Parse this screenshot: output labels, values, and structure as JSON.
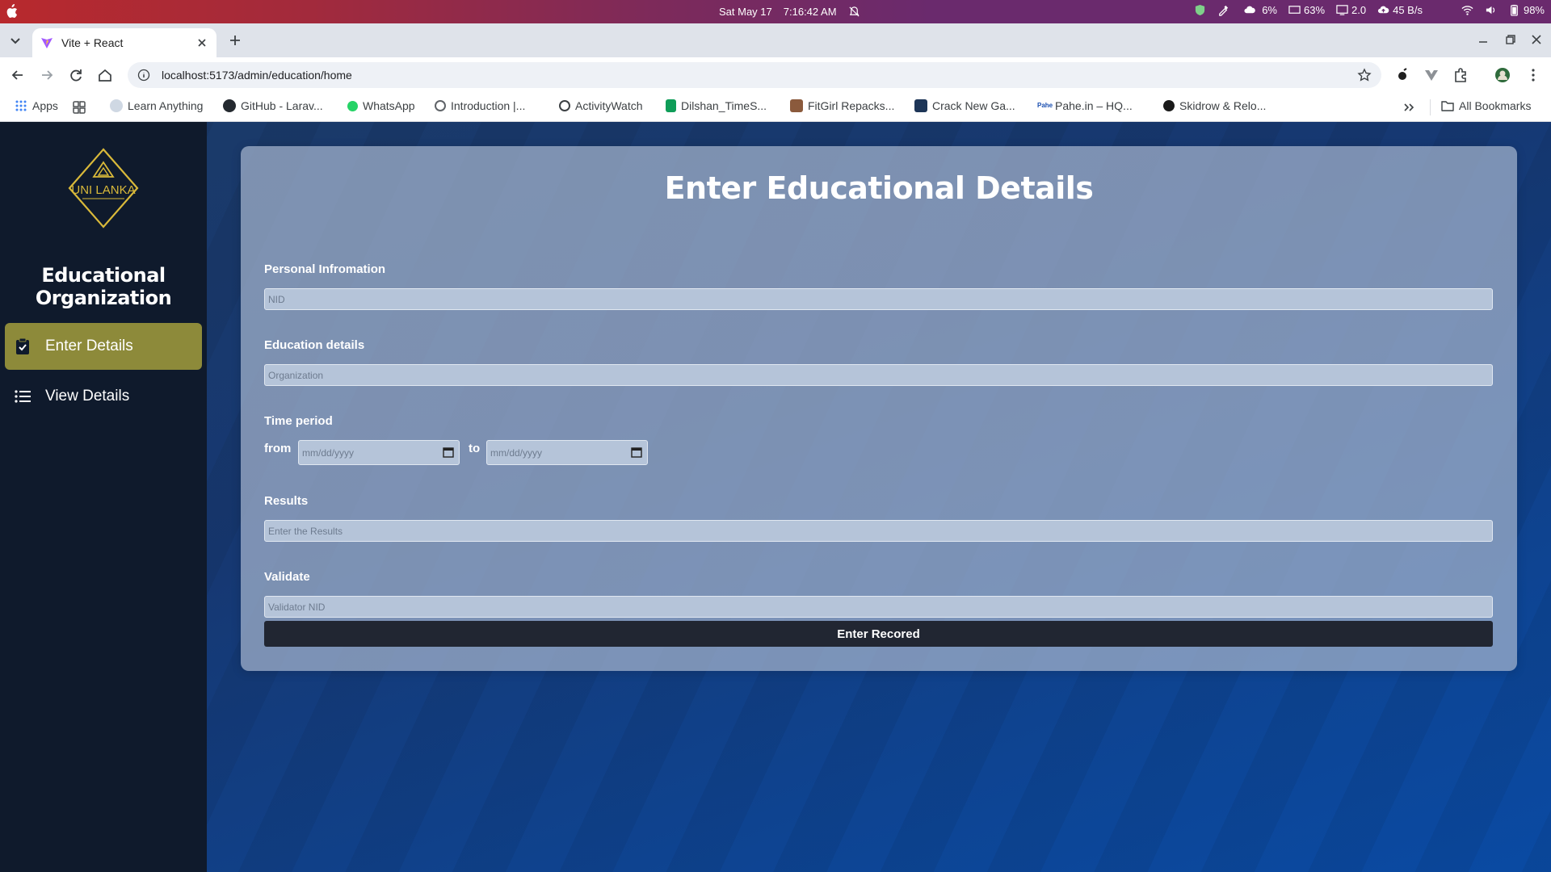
{
  "os_bar": {
    "date": "Sat May 17",
    "time": "7:16:42 AM",
    "weather": "6%",
    "battery_saver": "63%",
    "display": "2.0",
    "network": "45 B/s",
    "battery": "98%"
  },
  "browser": {
    "tab_title": "Vite + React",
    "url": "localhost:5173/admin/education/home",
    "bookmarks": [
      "Apps",
      "Learn Anything",
      "GitHub - Larav...",
      "WhatsApp",
      "Introduction |...",
      "ActivityWatch",
      "Dilshan_TimeS...",
      "FitGirl Repacks...",
      "Crack New Ga...",
      "Pahe.in – HQ...",
      "Skidrow & Relo..."
    ],
    "all_bookmarks": "All Bookmarks"
  },
  "sidebar": {
    "logo_text": "UNI LANKA",
    "title": "Educational Organization",
    "items": [
      {
        "label": "Enter Details",
        "icon": "clipboard-check-icon"
      },
      {
        "label": "View Details",
        "icon": "list-icon"
      }
    ]
  },
  "form": {
    "title": "Enter Educational Details",
    "personal_label": "Personal Infromation",
    "nid_placeholder": "NID",
    "education_label": "Education details",
    "organization_placeholder": "Organization",
    "time_label": "Time period",
    "from_label": "from",
    "to_label": "to",
    "date_placeholder": "mm/dd/yyyy",
    "results_label": "Results",
    "results_placeholder": "Enter the Results",
    "validate_label": "Validate",
    "validator_placeholder": "Validator NID",
    "submit_label": "Enter Recored"
  },
  "colors": {
    "sidebar_bg": "#0f1a2c",
    "active_item": "#8d8a3a",
    "submit_bg": "#212632",
    "logo_gold": "#d9b93a"
  }
}
